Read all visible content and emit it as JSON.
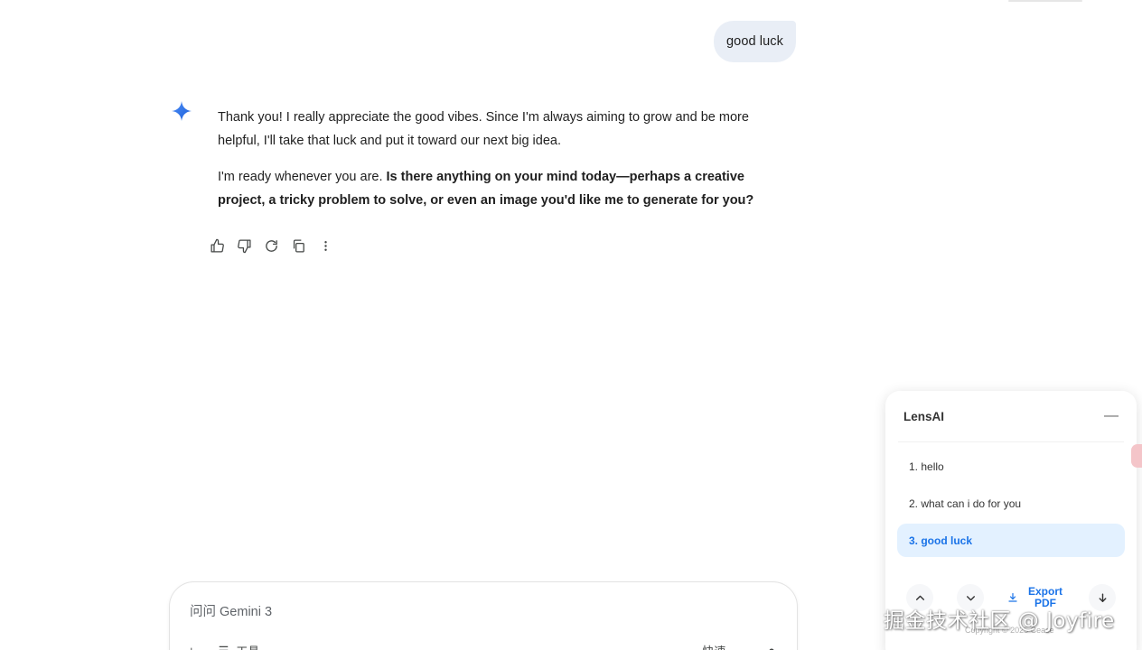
{
  "conversation": {
    "user_message": "good luck",
    "assistant": {
      "paragraph1": "Thank you! I really appreciate the good vibes. Since I'm always aiming to grow and be more helpful, I'll take that luck and put it toward our next big idea.",
      "paragraph2_plain": "I'm ready whenever you are. ",
      "paragraph2_bold": "Is there anything on your mind today—perhaps a creative project, a tricky problem to solve, or even an image you'd like me to generate for you?"
    },
    "actions": [
      "thumbs-up-icon",
      "thumbs-down-icon",
      "refresh-icon",
      "copy-icon",
      "more-vert-icon"
    ]
  },
  "input": {
    "placeholder": "问问 Gemini 3",
    "tools_label": "工具",
    "mode_label": "快速"
  },
  "lens_panel": {
    "title": "LensAI",
    "minimize_glyph": "—",
    "items": [
      {
        "label": "1. hello",
        "active": false
      },
      {
        "label": "2. what can i do for you",
        "active": false
      },
      {
        "label": "3. good luck",
        "active": true
      }
    ],
    "export_label": "Export PDF",
    "copyright": "Copyright © 2025 Cease"
  },
  "watermark": "掘金技术社区 @ Joyfire",
  "colors": {
    "user_bubble": "#e9eef6",
    "accent": "#1a73e8",
    "active_item_bg": "#e3f1ff"
  }
}
